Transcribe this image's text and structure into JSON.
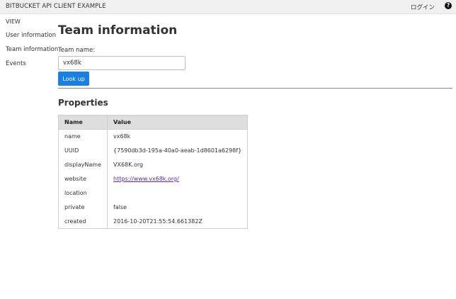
{
  "header": {
    "app_title": "BITBUCKET API CLIENT EXAMPLE",
    "login_label": "ログイン",
    "help_label": "?"
  },
  "sidebar": {
    "heading": "VIEW",
    "items": [
      {
        "label": "User information"
      },
      {
        "label": "Team information"
      },
      {
        "label": "Events"
      }
    ]
  },
  "main": {
    "title": "Team information",
    "team_name_label": "Team name:",
    "team_name_value": "vx68k",
    "lookup_button_label": "Look up",
    "properties_title": "Properties",
    "table": {
      "headers": [
        "Name",
        "Value"
      ],
      "rows": [
        {
          "name": "name",
          "value": "vx68k"
        },
        {
          "name": "UUID",
          "value": "{7590db3d-195a-40a0-aeab-1d8601a6298f}"
        },
        {
          "name": "displayName",
          "value": "VX68K.org"
        },
        {
          "name": "website",
          "value": "https://www.vx68k.org/"
        },
        {
          "name": "location",
          "value": ""
        },
        {
          "name": "private",
          "value": "false"
        },
        {
          "name": "created",
          "value": "2016-10-20T21:55:54.661382Z"
        }
      ]
    }
  },
  "colors": {
    "topbar_bg": "#f0f0f0",
    "button_blue": "#1a7fe0",
    "link_visited": "#5a2d91",
    "table_header_bg": "#dedede"
  }
}
